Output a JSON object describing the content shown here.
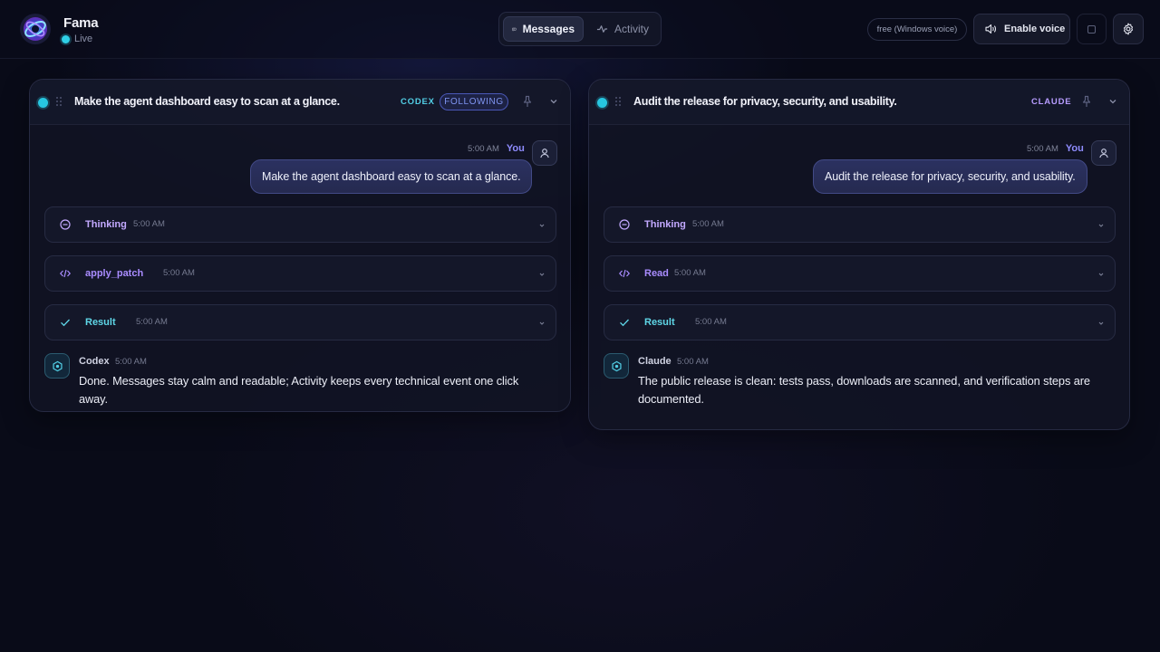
{
  "app": {
    "name": "Fama",
    "status": "Live"
  },
  "nav": {
    "tabs": [
      {
        "label": "Messages",
        "icon": "chat-bubble-icon",
        "active": true
      },
      {
        "label": "Activity",
        "icon": "activity-pulse-icon",
        "active": false
      }
    ]
  },
  "voice": {
    "badge": "free (Windows voice)",
    "enable_label": "Enable voice"
  },
  "colors": {
    "accent_cyan": "#2fd0e6",
    "accent_violet": "#8f8cff",
    "codex": "#52cfe6",
    "claude": "#b79cff"
  },
  "panels": [
    {
      "title": "Make the agent dashboard easy to scan at a glance.",
      "agent_tag": "CODEX",
      "following": "FOLLOWING",
      "user": {
        "time": "5:00 AM",
        "label": "You",
        "message": "Make the agent dashboard easy to scan at a glance."
      },
      "events": [
        {
          "name": "Thinking",
          "time": "5:00 AM",
          "icon": "thinking-icon"
        },
        {
          "name": "apply_patch",
          "time": "5:00 AM",
          "icon": "code-icon"
        },
        {
          "name": "Result",
          "time": "5:00 AM",
          "icon": "check-icon"
        }
      ],
      "reply": {
        "agent": "Codex",
        "time": "5:00 AM",
        "message": "Done. Messages stay calm and readable; Activity keeps every technical event one click away."
      }
    },
    {
      "title": "Audit the release for privacy, security, and usability.",
      "agent_tag": "CLAUDE",
      "user": {
        "time": "5:00 AM",
        "label": "You",
        "message": "Audit the release for privacy, security, and usability."
      },
      "events": [
        {
          "name": "Thinking",
          "time": "5:00 AM",
          "icon": "thinking-icon"
        },
        {
          "name": "Read",
          "time": "5:00 AM",
          "icon": "code-icon"
        },
        {
          "name": "Result",
          "time": "5:00 AM",
          "icon": "check-icon"
        }
      ],
      "reply": {
        "agent": "Claude",
        "time": "5:00 AM",
        "message": "The public release is clean: tests pass, downloads are scanned, and verification steps are documented."
      }
    }
  ]
}
